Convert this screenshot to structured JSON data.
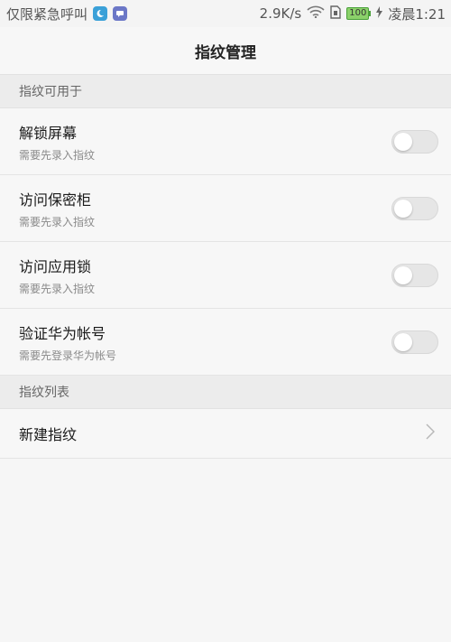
{
  "status_bar": {
    "carrier": "仅限紧急呼叫",
    "speed": "2.9K/s",
    "battery": "100",
    "time": "凌晨1:21"
  },
  "header": {
    "title": "指纹管理"
  },
  "section_usage": {
    "label": "指纹可用于",
    "items": [
      {
        "title": "解锁屏幕",
        "subtitle": "需要先录入指纹",
        "enabled": false
      },
      {
        "title": "访问保密柜",
        "subtitle": "需要先录入指纹",
        "enabled": false
      },
      {
        "title": "访问应用锁",
        "subtitle": "需要先录入指纹",
        "enabled": false
      },
      {
        "title": "验证华为帐号",
        "subtitle": "需要先登录华为帐号",
        "enabled": false
      }
    ]
  },
  "section_list": {
    "label": "指纹列表",
    "new_fingerprint": "新建指纹"
  }
}
